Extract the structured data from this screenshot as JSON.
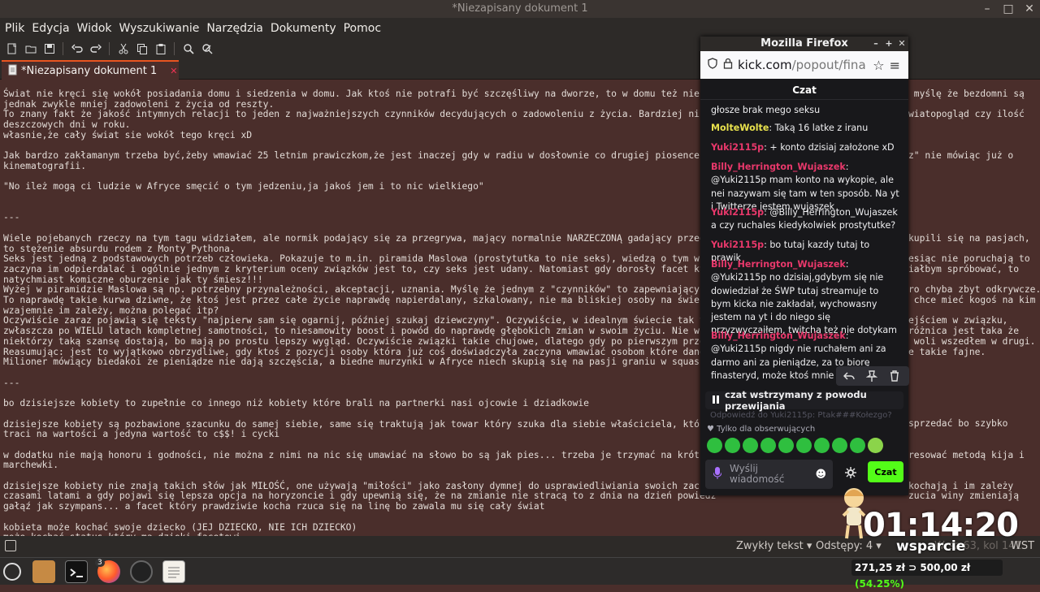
{
  "window": {
    "title": "*Niezapisany dokument 1"
  },
  "menu": [
    "Plik",
    "Edycja",
    "Widok",
    "Wyszukiwanie",
    "Narzędzia",
    "Dokumenty",
    "Pomoc"
  ],
  "tab": {
    "label": "*Niezapisany dokument 1"
  },
  "editor_lines": [
    "Świat nie kręci się wokół posiadania domu i siedzenia w domu. Jak ktoś nie potrafi być szczęśliwy na dworze, to w domu też nie bę",
    "jednak zwykle mniej zadowoleni z życia od reszty.",
    "To znany fakt że jakość intymnych relacji to jeden z najważniejszych czynników decydujących o zadowoleniu z życia. Bardziej niż z",
    "deszczowych dni w roku.",
    "własnie,że cały świat sie wokół tego kręci xD",
    "",
    "Jak bardzo zakłamanym trzeba być,żeby wmawiać 25 letnim prawiczkom,że jest inaczej gdy w radiu w dosłownie co drugiej piosence je",
    "kinematografii.",
    "",
    "\"No ileż mogą ci ludzie w Afryce smęcić o tym jedzeniu,ja jakoś jem i to nic wielkiego\"",
    "",
    "",
    "---",
    "",
    "Wiele pojebanych rzeczy na tym tagu widziałem, ale normik podający się za przegrywa, mający normalnie NARZECZONĄ gadający przegry",
    "to stężenie absurdu rodem z Monty Pythona.",
    "Seks jest jedną z podstawowych potrzeb człowieka. Pokazuje to m.in. piramida Maslowa (prostytutka to nie seks), wiedzą o tym wszy",
    "zaczyna im odpierdalać i ogólnie jednym z kryterium oceny związków jest to, czy seks jest udany. Natomiast gdy dorosły facet któr",
    "natychmiast komiczne oburzenie jak ty śmiesz!!!",
    "Wyżej w piramidzie Maslowa są np. potrzebny przynależności, akceptacji, uznania. Myślę że jednym z \"czynników\" to zapewniających",
    "To naprawdę takie kurwa dziwne, że ktoś jest przez całe życie naprawdę napierdalany, szkalowany, nie ma bliskiej osoby na świecie",
    "wzajemnie im zależy, można polegać itp?",
    "Oczywiście zaraz pojawią się teksty \"najpierw sam się ogarnij, później szukaj dziewczyny\". Oczywiście, w idealnym świecie tak to",
    "zwłaszcza po WIELU latach kompletnej samotności, to niesamowity boost i powód do naprawdę głębokich zmian w swoim życiu. Nie wszy",
    "niektórzy taką szansę dostają, bo mają po prostu lepszy wygląd. Oczywiście związki takie chujowe, dlatego gdy po pierwszym przekc",
    "Reasumując: jest to wyjątkowo obrzydliwe, gdy ktoś z pozycji osoby która już coś doświadczyła zaczyna wmawiać osobom które danej",
    "Milioner mówiący biedakoi że pieniądze nie dają szczęścia, a biedne murzynki w Afryce niech skupią się na pasji graniu w squasha",
    "",
    "---",
    "",
    "bo dzisiejsze kobiety to zupełnie co innego niż kobiety które brali na partnerki nasi ojcowie i dziadkowie",
    "",
    "dzisiejsze kobiety są pozbawione szacunku do samej siebie, same się traktują jak towar który szuka dla siebie właściciela, który",
    "traci na wartości a jedyna wartość to c$$! i cycki",
    "",
    "w dodatku nie mają honoru i godności, nie można z nimi na nic się umawiać na słowo bo są jak pies... trzeba je trzymać na krótkie",
    "marchewki.",
    "",
    "dzisiejsze kobiety nie znają takich słów jak MIŁOŚĆ, one używają \"miłości\" jako zasłony dymnej do usprawiedliwiania swoich zachow",
    "czasami latami a gdy pojawi się lepsza opcja na horyzoncie i gdy upewnią się, że na zmianie nie stracą to z dnia na dzień powiedz",
    "gałąź jak szympans... a facet który prawdziwie kocha rzuca się na linę bo zawala mu się cały świat",
    "",
    "kobieta może kochać swoje dziecko (JEJ DZIECKO, NIE ICH DZIECKO)",
    "może kochać status który ma dzięki facetowi"
  ],
  "editor_right_fragments": [
    {
      "line": 0,
      "text": " myślę że bezdomni są"
    },
    {
      "line": 2,
      "text": "wiatopogląd czy ilość"
    },
    {
      "line": 6,
      "text": "z\" nie mówiąc już o"
    },
    {
      "line": 14,
      "text": "kupili się na pasjach,"
    },
    {
      "line": 16,
      "text": "esiąc nie poruchają to"
    },
    {
      "line": 17,
      "text": "iałbym spróbować, to"
    },
    {
      "line": 19,
      "text": "ro chyba zbyt odkrywcze."
    },
    {
      "line": 20,
      "text": " chce mieć kogoś na kim"
    },
    {
      "line": 22,
      "text": "ejściem w związku,"
    },
    {
      "line": 23,
      "text": "różnica jest taka że"
    },
    {
      "line": 24,
      "text": " woli wszedłem w drugi."
    },
    {
      "line": 25,
      "text": "e takie fajne."
    },
    {
      "line": 32,
      "text": "sprzedać bo szybko"
    },
    {
      "line": 35,
      "text": "resować metodą kija i"
    },
    {
      "line": 38,
      "text": "kochają i im zależy"
    },
    {
      "line": 39,
      "text": "zucia winy zmieniają"
    }
  ],
  "statusbar": {
    "syntax": "Zwykły tekst ▾",
    "tabs": "Odstępy: 4 ▾",
    "position": "Wrsz 63, kol 141",
    "mode": "WST"
  },
  "firefox": {
    "title": "Mozilla Firefox",
    "url_domain": "kick.com",
    "url_path": "/popout/fina",
    "chat_title": "Czat",
    "messages": [
      {
        "user": "",
        "color": "#efeff1",
        "text": "głosze brak mego seksu"
      },
      {
        "user": "MolteWolte",
        "color": "#e8e14d",
        "text": "Taką 16 latke z iranu"
      },
      {
        "user": "Yuki2115p",
        "color": "#e8386b",
        "text": "+ konto dzisiaj założone xD"
      },
      {
        "user": "Billy_Herrington_Wujaszek",
        "color": "#e8386b",
        "text": "@Yuki2115p mam konto na wykopie, ale nei nazywam się tam w ten sposób. Na yt i Twitterze jestem wujaszek"
      },
      {
        "user": "Yuki2115p",
        "color": "#e8386b",
        "text": "@Billy_Herrington_Wujaszek a czy ruchales kiedykolwiek prostytutke?"
      },
      {
        "user": "Yuki2115p",
        "color": "#e8386b",
        "text": "bo tutaj kazdy tutaj to prawik"
      },
      {
        "user": "Billy_Herrington_Wujaszek",
        "color": "#e8386b",
        "text": "@Yuki2115p no dzisiaj,gdybym się nie dowiedział że ŚWP tutaj streamuje to bym kicka nie zakładał, wychowasny jestem na yt i do niego się przyzwyczaiłem, twitcha też nie dotykam"
      },
      {
        "user": "Billy_Herrington_Wujaszek",
        "color": "#e8386b",
        "text": "@Yuki2115p nigdy nie ruchałem ani za darmo ani za pieniądze, za to biorę finasteryd, może ktoś mnie skojarzy xD"
      }
    ],
    "paused_label": "czat wstrzymany z powodu przewijania",
    "reply_ghost": "Odpowiedź do Yuki2115p: Ptak###Kołezgo?",
    "followers_only": "Tylko dla obserwujących",
    "input_placeholder": "Wyślij wiadomość",
    "send_label": "Czat"
  },
  "overlay": {
    "timer": "01:14:20",
    "support_label": "wsparcie",
    "goal_current": "271,25 zł ⊃ 500,00 zł",
    "goal_percent": "(54.25%)",
    "goal_progress": 0.5425
  },
  "taskbar": {
    "firefox_badge": "3"
  }
}
